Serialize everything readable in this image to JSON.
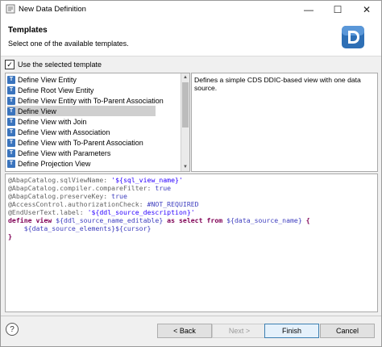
{
  "window": {
    "title": "New Data Definition"
  },
  "header": {
    "title": "Templates",
    "subtitle": "Select one of the available templates."
  },
  "use_template": {
    "label": "Use the selected template",
    "checked": true
  },
  "templates": [
    {
      "label": "Define View Entity"
    },
    {
      "label": "Define Root View Entity"
    },
    {
      "label": "Define View Entity with To-Parent Association"
    },
    {
      "label": "Define View",
      "selected": true
    },
    {
      "label": "Define View with Join"
    },
    {
      "label": "Define View with Association"
    },
    {
      "label": "Define View with To-Parent Association"
    },
    {
      "label": "Define View with Parameters"
    },
    {
      "label": "Define Projection View"
    }
  ],
  "description": "Defines a simple CDS DDIC-based view with one data source.",
  "code": {
    "l1a": "@AbapCatalog.sqlViewName: ",
    "l1b": "'${sql_view_name}'",
    "l2a": "@AbapCatalog.compiler.compareFilter: ",
    "l2b": "true",
    "l3a": "@AbapCatalog.preserveKey: ",
    "l3b": "true",
    "l4a": "@AccessControl.authorizationCheck: ",
    "l4b": "#NOT_REQUIRED",
    "l5a": "@EndUserText.label: ",
    "l5b": "'${ddl_source_description}'",
    "l6a": "define view ",
    "l6b": "${ddl_source_name_editable}",
    "l6c": " as select from ",
    "l6d": "${data_source_name}",
    "l6e": " {",
    "l7": "    ${data_source_elements}${cursor}",
    "l8": "}"
  },
  "buttons": {
    "back": "< Back",
    "next": "Next >",
    "finish": "Finish",
    "cancel": "Cancel"
  },
  "colors": {
    "accent": "#3a74bd",
    "selection": "#cfcfcf"
  }
}
